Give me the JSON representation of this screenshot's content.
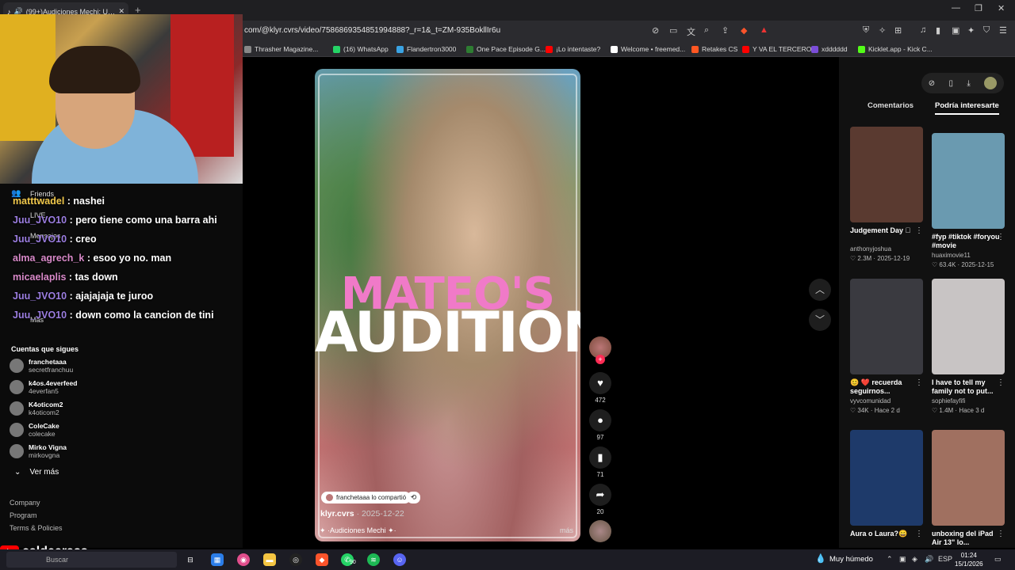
{
  "browser": {
    "tab_title": "(99+)Audiciones Mechi: Un V",
    "url": "com/@klyr.cvrs/video/7586869354851994888?_r=1&_t=ZM-935BokllIr6u",
    "bookmarks": [
      {
        "label": "Thrasher Magazine...",
        "color": "#888888"
      },
      {
        "label": "(16) WhatsApp",
        "color": "#25d366"
      },
      {
        "label": "Flandertron3000",
        "color": "#3aa3e3"
      },
      {
        "label": "One Pace Episode G...",
        "color": "#2e7d32"
      },
      {
        "label": "¡Lo intentaste?",
        "color": "#ff0000"
      },
      {
        "label": "Welcome • freemed...",
        "color": "#ffffff"
      },
      {
        "label": "Retakes CS",
        "color": "#ff5722"
      },
      {
        "label": "Y VA EL TERCERO",
        "color": "#ff0000"
      },
      {
        "label": "xdddddd",
        "color": "#7b4dd8"
      },
      {
        "label": "Kicklet.app - Kick C...",
        "color": "#53fc18"
      }
    ]
  },
  "stream": {
    "streamer": "caldeerass"
  },
  "chat": [
    {
      "user": "matttwadel",
      "msg": ": nashei",
      "color": "gold"
    },
    {
      "user": "Juu_JVO10",
      "msg": ": pero tiene como una barra ahi",
      "color": "purple"
    },
    {
      "user": "Juu_JVO10",
      "msg": ": creo",
      "color": "purple"
    },
    {
      "user": "alma_agrech_k",
      "msg": ": esoo yo no. man",
      "color": "pink"
    },
    {
      "user": "micaelaplis",
      "msg": ": tas down",
      "color": "pink"
    },
    {
      "user": "Juu_JVO10",
      "msg": ": ajajajaja te juroo",
      "color": "purple"
    },
    {
      "user": "Juu_JVO10",
      "msg": ": down como la cancion de tini",
      "color": "purple"
    }
  ],
  "sidebar": {
    "nav": [
      "Friends",
      "LIVE",
      "Mensajes",
      "Mas"
    ],
    "following_header": "Cuentas que sigues",
    "following": [
      {
        "name": "franchetaaa",
        "handle": "secretfranchuu"
      },
      {
        "name": "k4os.4everfeed",
        "handle": "4everfan5"
      },
      {
        "name": "K4oticom2",
        "handle": "k4oticom2"
      },
      {
        "name": "ColeCake",
        "handle": "colecake"
      },
      {
        "name": "Mirko Vigna",
        "handle": "mirkovgna"
      }
    ],
    "ver_mas": "Ver más",
    "footer": [
      "Company",
      "Program",
      "Terms & Policies"
    ]
  },
  "video": {
    "title_line1": "MATEO'S",
    "title_line2": "AUDITION",
    "shared_by": "franchetaaa lo compartió",
    "author": "klyr.cvrs",
    "date": "· 2025-12-22",
    "description": "✦ ·Audiciones Mechi ✦·",
    "more": "más",
    "likes": "472",
    "comments": "97",
    "saves": "71",
    "shares": "20"
  },
  "right_panel": {
    "tabs": [
      "Comentarios",
      "Podría interesarte"
    ],
    "cards": [
      {
        "title": "Judgement Day 🏻",
        "author": "anthonyjoshua",
        "likes": "2.3M",
        "date": "2025-12-19",
        "thumb": "#5a3a30"
      },
      {
        "title": "#fyp #tiktok #foryou #movie",
        "author": "huaximovie11",
        "likes": "63.4K",
        "date": "2025-12-15",
        "thumb": "#6a9ab0"
      },
      {
        "title": "😊 ❤️ recuerda seguirnos...",
        "author": "vyvcomunidad",
        "likes": "34K",
        "date": "Hace 2 d",
        "thumb": "#3a3a40"
      },
      {
        "title": "I have to tell my family not to put...",
        "author": "sophiefayfifi",
        "likes": "1.4M",
        "date": "Hace 3 d",
        "thumb": "#c8c4c4"
      },
      {
        "title": "Aura o Laura?😄",
        "author": "",
        "likes": "",
        "date": "",
        "thumb": "#1e3a6a"
      },
      {
        "title": "unboxing del iPad Air 13\" lo...",
        "author": "",
        "likes": "",
        "date": "",
        "thumb": "#a07060"
      }
    ]
  },
  "taskbar": {
    "weather": "Muy húmedo",
    "lang": "ESP",
    "time": "01:24",
    "date": "15/1/2026",
    "search_placeholder": "Buscar",
    "whatsapp_badge": "90"
  }
}
